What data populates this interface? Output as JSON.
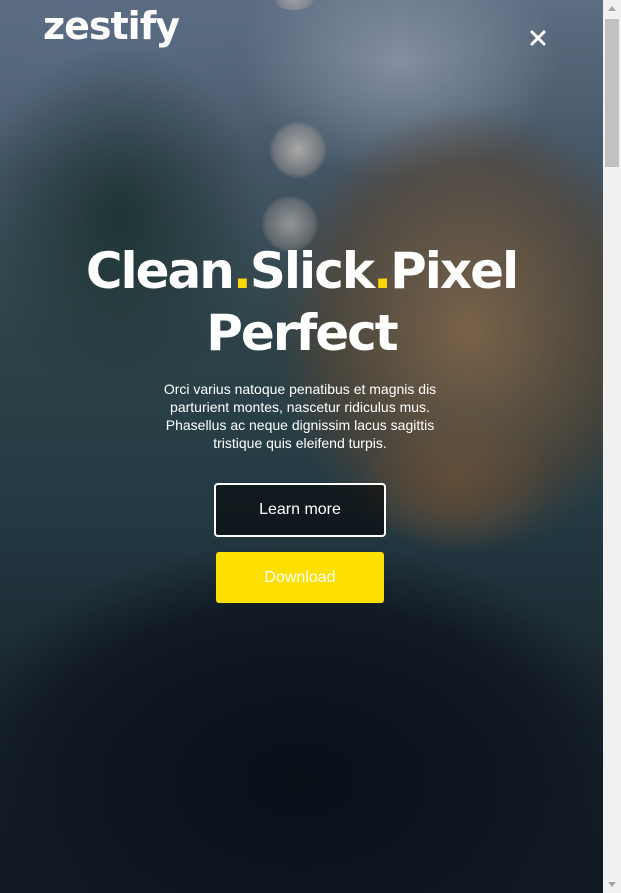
{
  "brand": {
    "logo_text": "zestify"
  },
  "nav": {
    "close_icon": "close-icon"
  },
  "hero": {
    "headline_words": [
      "Clean",
      "Slick",
      "Pixel"
    ],
    "headline_separator": ".",
    "headline_line2": "Perfect",
    "description": "Orci varius natoque penatibus et magnis dis parturient montes, nascetur ridiculus mus. Phasellus ac neque dignissim lacus sagittis tristique quis eleifend turpis.",
    "learn_more_label": "Learn more",
    "download_label": "Download"
  },
  "colors": {
    "accent": "#fddf00",
    "dot": "#ffd60a",
    "text": "#ffffff"
  },
  "scrollbar": {
    "up_icon": "scroll-up-arrow-icon",
    "down_icon": "scroll-down-arrow-icon"
  }
}
